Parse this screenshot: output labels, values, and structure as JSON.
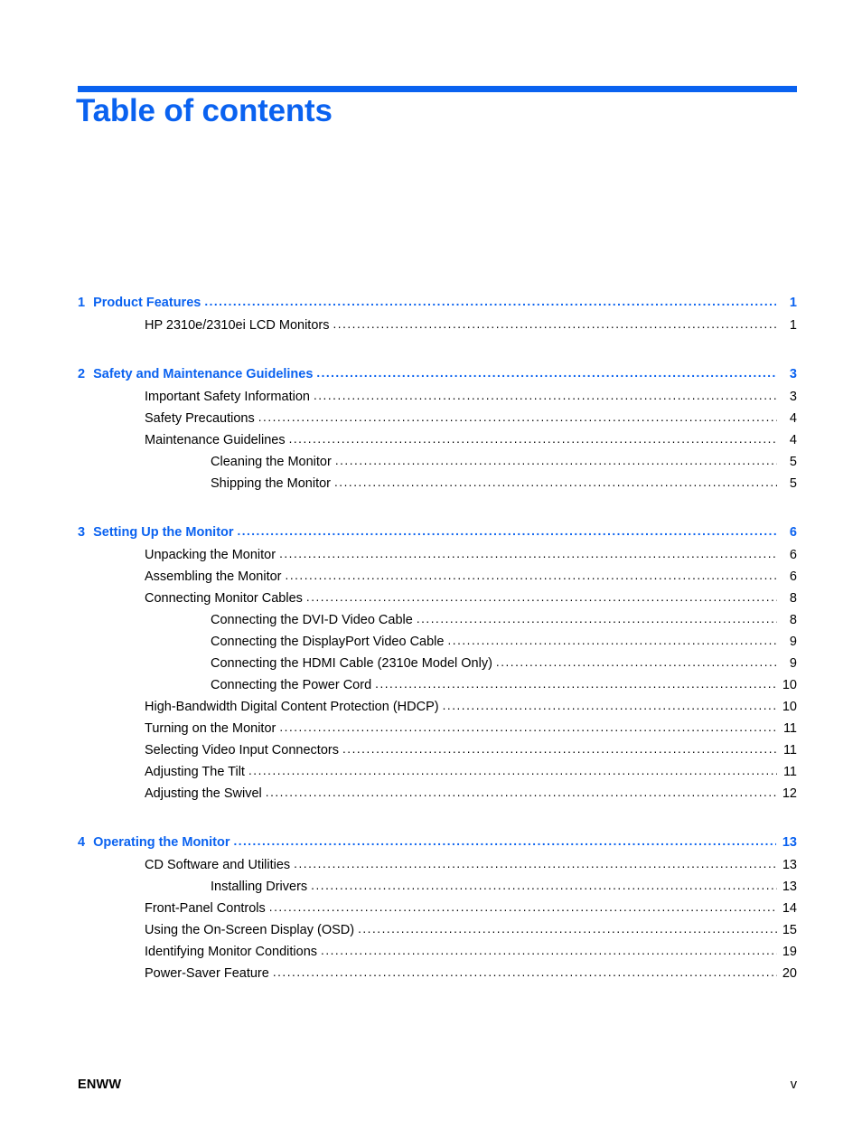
{
  "document": {
    "title": "Table of contents",
    "accent_color": "#0a62f0",
    "leader_dots": "..........................................................................................................................................................................................................................."
  },
  "toc": {
    "groups": [
      {
        "chapter": {
          "number": "1",
          "label": "Product Features",
          "page": "1"
        },
        "entries": [
          {
            "level": 2,
            "label": "HP 2310e/2310ei LCD Monitors",
            "page": "1"
          }
        ]
      },
      {
        "chapter": {
          "number": "2",
          "label": "Safety and Maintenance Guidelines",
          "page": "3"
        },
        "entries": [
          {
            "level": 2,
            "label": "Important Safety Information",
            "page": "3"
          },
          {
            "level": 2,
            "label": "Safety Precautions",
            "page": "4"
          },
          {
            "level": 2,
            "label": "Maintenance Guidelines",
            "page": "4"
          },
          {
            "level": 3,
            "label": "Cleaning the Monitor",
            "page": "5"
          },
          {
            "level": 3,
            "label": "Shipping the Monitor",
            "page": "5"
          }
        ]
      },
      {
        "chapter": {
          "number": "3",
          "label": "Setting Up the Monitor",
          "page": "6"
        },
        "entries": [
          {
            "level": 2,
            "label": "Unpacking the Monitor",
            "page": "6"
          },
          {
            "level": 2,
            "label": "Assembling the Monitor",
            "page": "6"
          },
          {
            "level": 2,
            "label": "Connecting Monitor Cables",
            "page": "8"
          },
          {
            "level": 3,
            "label": "Connecting the DVI-D Video Cable",
            "page": "8"
          },
          {
            "level": 3,
            "label": "Connecting the DisplayPort Video Cable",
            "page": "9"
          },
          {
            "level": 3,
            "label": "Connecting the HDMI Cable (2310e Model Only)",
            "page": "9"
          },
          {
            "level": 3,
            "label": "Connecting the Power Cord",
            "page": "10"
          },
          {
            "level": 2,
            "label": "High-Bandwidth Digital Content Protection (HDCP)",
            "page": "10"
          },
          {
            "level": 2,
            "label": "Turning on the Monitor",
            "page": "11"
          },
          {
            "level": 2,
            "label": "Selecting Video Input Connectors",
            "page": "11"
          },
          {
            "level": 2,
            "label": "Adjusting The Tilt",
            "page": "11"
          },
          {
            "level": 2,
            "label": "Adjusting the Swivel",
            "page": "12"
          }
        ]
      },
      {
        "chapter": {
          "number": "4",
          "label": "Operating the Monitor",
          "page": "13"
        },
        "entries": [
          {
            "level": 2,
            "label": "CD Software and Utilities",
            "page": "13"
          },
          {
            "level": 4,
            "label": "Installing Drivers",
            "page": "13"
          },
          {
            "level": 2,
            "label": "Front-Panel Controls",
            "page": "14"
          },
          {
            "level": 2,
            "label": "Using the On-Screen Display (OSD)",
            "page": "15"
          },
          {
            "level": 2,
            "label": "Identifying Monitor Conditions",
            "page": "19"
          },
          {
            "level": 2,
            "label": "Power-Saver Feature",
            "page": "20"
          }
        ]
      }
    ]
  },
  "footer": {
    "left": "ENWW",
    "right": "v"
  }
}
